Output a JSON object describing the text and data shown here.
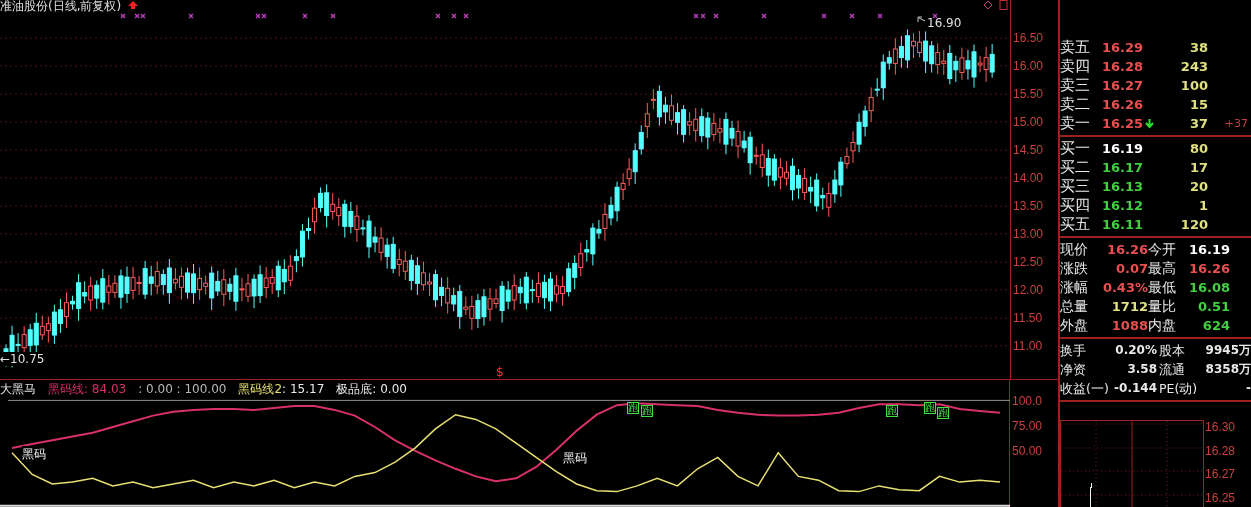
{
  "title": "准油股份(日线,前复权)",
  "price_chart": {
    "high_label": "16.90",
    "low_label": "←10.75",
    "signal_label": "$"
  },
  "price_axis": [
    "16.50",
    "16.00",
    "15.50",
    "15.00",
    "14.50",
    "14.00",
    "13.50",
    "13.00",
    "12.50",
    "12.00",
    "11.50",
    "11.00"
  ],
  "indicator": {
    "name": "大黑马",
    "legend": [
      {
        "kind": "series",
        "text": ": 84.03",
        "color": "#d8306a"
      },
      {
        "kind": "plain",
        "text": ": 0.00 : 100.00",
        "color": "#b8b8b8"
      },
      {
        "kind": "series",
        "text": ": 15.17",
        "color": "#e8e8e8"
      },
      {
        "kind": "plain",
        "text": "极品底: 0.00",
        "color": "#e8e8e8"
      }
    ],
    "line_labels": [
      "黑码",
      "黑码"
    ],
    "run_marks": [
      "跑",
      "跑",
      "跑",
      "跑",
      "跑"
    ],
    "chart_data": {
      "type": "line",
      "ylim": [
        -11,
        100
      ],
      "yticks": [
        {
          "value": 100,
          "label": "100.0"
        },
        {
          "value": 75,
          "label": "75.00"
        },
        {
          "value": 50,
          "label": "50.00"
        }
      ],
      "series": [
        {
          "name": "黑码线",
          "color": "#d8306a",
          "values": [
            50,
            54,
            58,
            62,
            66,
            72,
            78,
            84,
            88,
            90,
            91,
            91,
            90,
            92,
            94,
            94,
            90,
            84,
            72,
            58,
            47,
            37,
            28,
            20,
            15,
            18,
            30,
            48,
            68,
            85,
            95,
            97,
            96,
            95,
            94,
            90,
            87,
            85,
            84,
            84,
            85,
            87,
            92,
            96,
            96,
            95,
            96,
            91,
            89,
            87
          ]
        },
        {
          "name": "黑码线2",
          "color": "#e8e070",
          "values": [
            45,
            22,
            12,
            14,
            18,
            10,
            14,
            8,
            12,
            16,
            8,
            14,
            10,
            16,
            8,
            14,
            10,
            20,
            24,
            35,
            50,
            70,
            85,
            80,
            70,
            55,
            40,
            25,
            12,
            5,
            4,
            10,
            18,
            10,
            28,
            40,
            20,
            10,
            45,
            20,
            16,
            5,
            4,
            10,
            6,
            5,
            20,
            14,
            16,
            14
          ]
        }
      ]
    }
  },
  "quote": {
    "asks": [
      {
        "label": "卖五",
        "price": "16.29",
        "volume": "38",
        "down_arrow": false
      },
      {
        "label": "卖四",
        "price": "16.28",
        "volume": "243",
        "down_arrow": false
      },
      {
        "label": "卖三",
        "price": "16.27",
        "volume": "100",
        "down_arrow": false
      },
      {
        "label": "卖二",
        "price": "16.26",
        "volume": "15",
        "down_arrow": false
      },
      {
        "label": "卖一",
        "price": "16.25",
        "volume": "37",
        "down_arrow": true,
        "change": "+37"
      }
    ],
    "bids": [
      {
        "label": "买一",
        "price": "16.19",
        "volume": "80",
        "color": "#ffffff"
      },
      {
        "label": "买二",
        "price": "16.17",
        "volume": "17",
        "color": "#40d040"
      },
      {
        "label": "买三",
        "price": "16.13",
        "volume": "20",
        "color": "#40d040"
      },
      {
        "label": "买四",
        "price": "16.12",
        "volume": "1",
        "color": "#40d040"
      },
      {
        "label": "买五",
        "price": "16.11",
        "volume": "120",
        "color": "#40d040"
      }
    ],
    "stats": [
      {
        "cells": [
          {
            "label": "现价",
            "value": "16.26",
            "color": "#e85050"
          },
          {
            "label": "今开",
            "value": "16.19",
            "color": "#ffffff"
          }
        ]
      },
      {
        "cells": [
          {
            "label": "涨跌",
            "value": "0.07",
            "color": "#e85050"
          },
          {
            "label": "最高",
            "value": "16.26",
            "color": "#e85050"
          }
        ]
      },
      {
        "cells": [
          {
            "label": "涨幅",
            "value": "0.43%",
            "color": "#e85050"
          },
          {
            "label": "最低",
            "value": "16.08",
            "color": "#40d040"
          }
        ]
      },
      {
        "cells": [
          {
            "label": "总量",
            "value": "1712",
            "color": "#e0e080"
          },
          {
            "label": "量比",
            "value": "0.51",
            "color": "#40d040"
          }
        ]
      },
      {
        "cells": [
          {
            "label": "外盘",
            "value": "1088",
            "color": "#e85050"
          },
          {
            "label": "内盘",
            "value": "624",
            "color": "#40d040"
          }
        ]
      }
    ],
    "extra": [
      {
        "label": "换手",
        "value": "0.20%",
        "label2": "股本",
        "value2": "9945万"
      },
      {
        "label": "净资",
        "value": "3.58",
        "label2": "流通",
        "value2": "8358万"
      },
      {
        "label": "收益(一)",
        "value": "-0.144",
        "label2": "PE(动)",
        "value2": "-"
      }
    ]
  },
  "intraday_axis": [
    "16.30",
    "16.28",
    "16.27",
    "16.25"
  ]
}
